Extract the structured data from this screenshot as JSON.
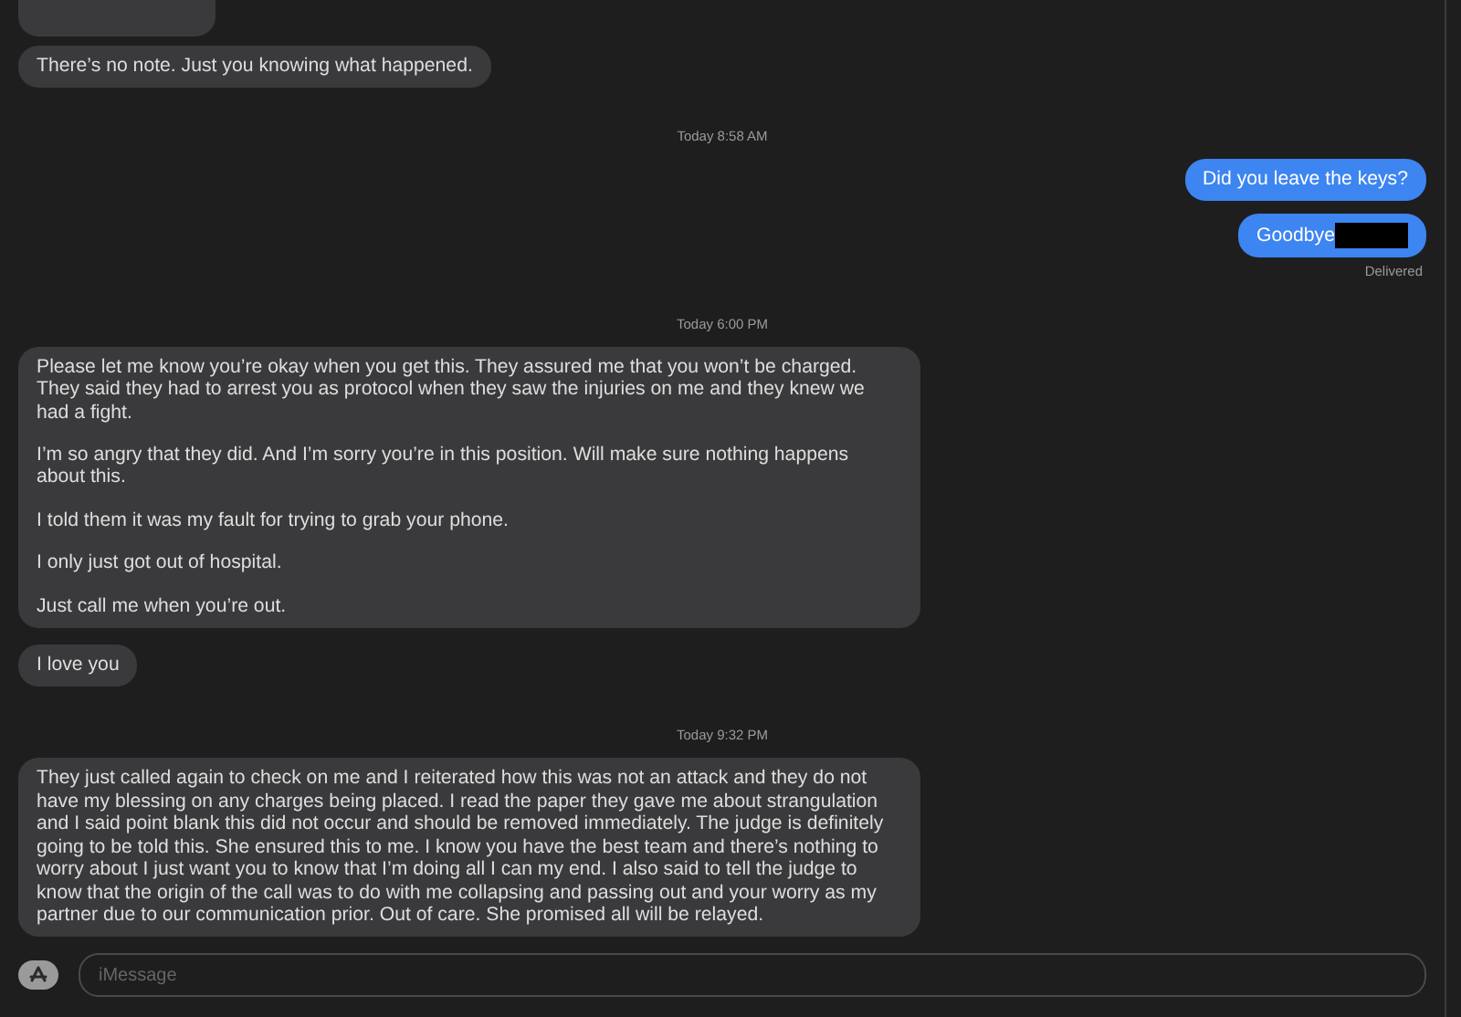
{
  "messages": [
    {
      "kind": "incoming",
      "cut_top": true
    },
    {
      "kind": "incoming",
      "paragraphs": [
        "There’s no note. Just you knowing what happened."
      ]
    },
    {
      "kind": "timestamp",
      "text": "Today 8:58 AM"
    },
    {
      "kind": "outgoing",
      "text": "Did you leave the keys?",
      "redacted": false
    },
    {
      "kind": "outgoing",
      "text": "Goodbye",
      "redacted": true,
      "status": "Delivered"
    },
    {
      "kind": "timestamp",
      "text": "Today 6:00 PM"
    },
    {
      "kind": "incoming",
      "paragraphs": [
        "Please let me know you’re okay when you get this. They assured me that you won’t be charged. They said they had to arrest you as protocol when they saw the injuries on me and they knew we had a fight.",
        "I’m so angry that they did. And I’m sorry you’re in this position. Will make sure nothing happens about this.",
        "I told them it was my fault for trying to grab your phone.",
        "I only just got out of hospital.",
        "Just call me when you’re out."
      ]
    },
    {
      "kind": "incoming",
      "paragraphs": [
        "I love you"
      ]
    },
    {
      "kind": "timestamp",
      "text": "Today 9:32 PM"
    },
    {
      "kind": "incoming",
      "paragraphs": [
        "They just called again to check on me and I reiterated how this was not an attack and they do not have my blessing on any charges being placed. I read the paper they gave me about strangulation and I said point blank this did not occur and should be removed immediately. The judge is definitely going to be told this. She ensured this to me. I know you have the best team and there’s nothing to worry about I just want you to know that I’m doing all I can my end. I also said to tell the judge to know that the origin of the call was to do with me collapsing and passing out and your worry as my partner due to our communication prior. Out of care. She promised all will be relayed."
      ]
    }
  ],
  "composer": {
    "placeholder": "iMessage"
  }
}
